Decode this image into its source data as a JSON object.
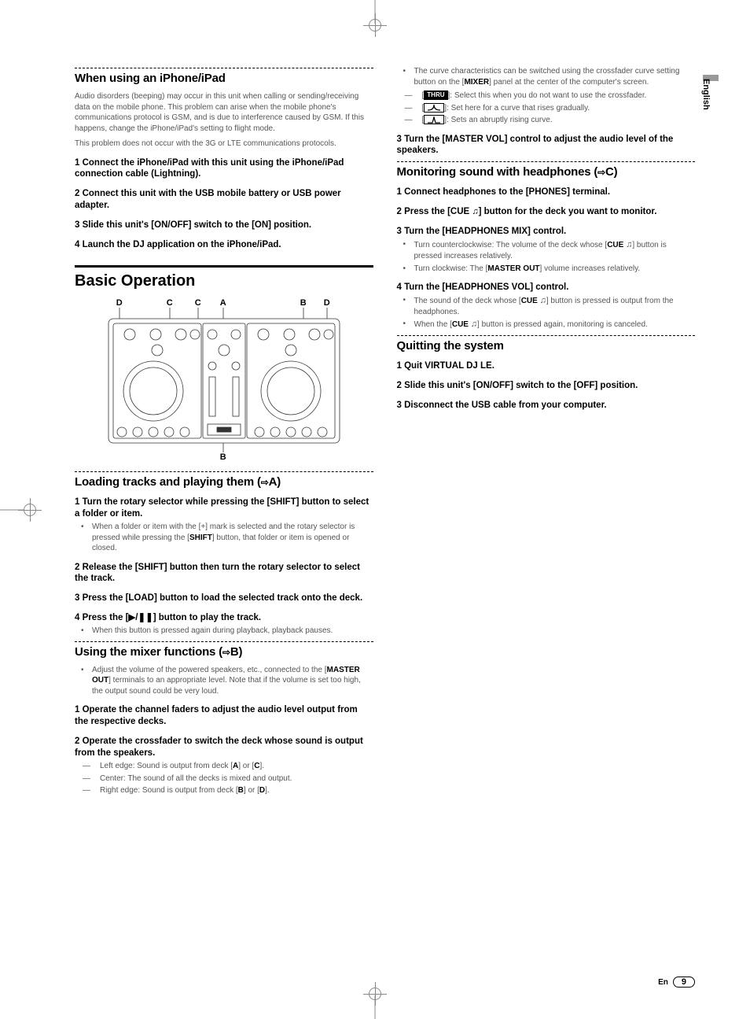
{
  "side_tab": "English",
  "footer": {
    "lang": "En",
    "page": "9"
  },
  "left": {
    "sec1_title": "When using an iPhone/iPad",
    "sec1_p1": "Audio disorders (beeping) may occur in this unit when calling or sending/receiving data on the mobile phone. This problem can arise when the mobile phone's communications protocol is GSM, and is due to interference caused by GSM. If this happens, change the iPhone/iPad's setting to flight mode.",
    "sec1_p2": "This problem does not occur with the 3G or LTE communications protocols.",
    "sec1_step1": "1   Connect the iPhone/iPad with this unit using the iPhone/iPad connection cable (Lightning).",
    "sec1_step2": "2   Connect this unit with the USB mobile battery or USB power adapter.",
    "sec1_step3": "3   Slide this unit's [ON/OFF] switch to the [ON] position.",
    "sec1_step4": "4   Launch the DJ application on the iPhone/iPad.",
    "sec2_title": "Basic Operation",
    "diagram_labels": {
      "D1": "D",
      "C1": "C",
      "C2": "C",
      "A": "A",
      "B1": "B",
      "D2": "D",
      "B2": "B"
    },
    "sec3_title_prefix": "Loading tracks and playing them (",
    "sec3_title_suffix": "A)",
    "sec3_step1": "1   Turn the rotary selector while pressing the [SHIFT] button to select a folder or item.",
    "sec3_b1a": "When a folder or item with the [+] mark is selected and the rotary selector is pressed while pressing the [",
    "sec3_b1b": "SHIFT",
    "sec3_b1c": "] button, that folder or item is opened or closed.",
    "sec3_step2": "2   Release the [SHIFT] button then turn the rotary selector to select the track.",
    "sec3_step3": "3   Press the [LOAD] button to load the selected track onto the deck.",
    "sec3_step4_prefix": "4   Press the [",
    "sec3_step4_suffix": "] button to play the track.",
    "sec3_b2": "When this button is pressed again during playback, playback pauses.",
    "sec4_title_prefix": "Using the mixer functions (",
    "sec4_title_suffix": "B)",
    "sec4_b1a": "Adjust the volume of the powered speakers, etc., connected to the [",
    "sec4_b1b": "MASTER OUT",
    "sec4_b1c": "] terminals to an appropriate level. Note that if the volume is set too high, the output sound could be very loud.",
    "sec4_step1": "1   Operate the channel faders to adjust the audio level output from the respective decks.",
    "sec4_step2": "2   Operate the crossfader to switch the deck whose sound is output from the speakers.",
    "sec4_d1a": "Left edge: Sound is output from deck [",
    "sec4_d1b": "A",
    "sec4_d1c": "] or [",
    "sec4_d1d": "C",
    "sec4_d1e": "].",
    "sec4_d2": "Center: The sound of all the decks is mixed and output.",
    "sec4_d3a": "Right edge: Sound is output from deck [",
    "sec4_d3b": "B",
    "sec4_d3c": "] or [",
    "sec4_d3d": "D",
    "sec4_d3e": "]."
  },
  "right": {
    "top_b1a": "The curve characteristics can be switched using the crossfader curve setting button on the [",
    "top_b1b": "MIXER",
    "top_b1c": "] panel at the center of the computer's screen.",
    "top_d1_label": "THRU",
    "top_d1": ": Select this when you do not want to use the crossfader.",
    "top_d2": ": Set here for a curve that rises gradually.",
    "top_d3": ": Sets an abruptly rising curve.",
    "top_step3": "3   Turn the [MASTER VOL] control to adjust the audio level of the speakers.",
    "sec5_title_prefix": "Monitoring sound with headphones (",
    "sec5_title_suffix": "C)",
    "sec5_step1": "1   Connect headphones to the [PHONES] terminal.",
    "sec5_step2_prefix": "2   Press the [CUE ",
    "sec5_step2_suffix": "] button for the deck you want to monitor.",
    "sec5_step3": "3   Turn the [HEADPHONES MIX] control.",
    "sec5_b1a": "Turn counterclockwise: The volume of the deck whose [",
    "sec5_b1b": "CUE ",
    "sec5_b1c": "] button is pressed increases relatively.",
    "sec5_b2a": "Turn clockwise: The [",
    "sec5_b2b": "MASTER OUT",
    "sec5_b2c": "] volume increases relatively.",
    "sec5_step4": "4   Turn the [HEADPHONES VOL] control.",
    "sec5_b3a": "The sound of the deck whose [",
    "sec5_b3b": "CUE ",
    "sec5_b3c": "] button is pressed is output from the headphones.",
    "sec5_b4a": "When the [",
    "sec5_b4b": "CUE ",
    "sec5_b4c": "] button is pressed again, monitoring is canceled.",
    "sec6_title": "Quitting the system",
    "sec6_step1": "1   Quit VIRTUAL DJ LE.",
    "sec6_step2": "2   Slide this unit's [ON/OFF] switch to the [OFF] position.",
    "sec6_step3": "3   Disconnect the USB cable from your computer."
  }
}
